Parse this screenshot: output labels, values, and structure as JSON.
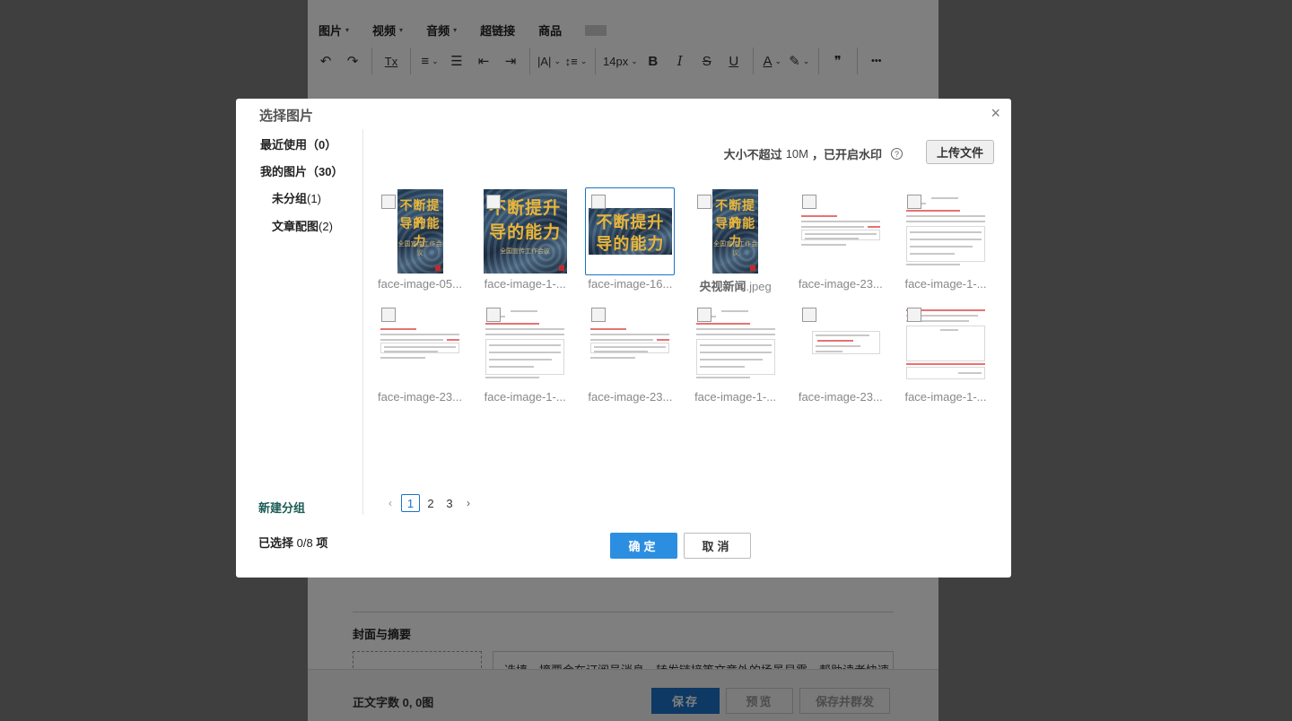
{
  "editor": {
    "insert_menu": [
      {
        "label": "图片",
        "dropdown": true
      },
      {
        "label": "视频",
        "dropdown": true
      },
      {
        "label": "音频",
        "dropdown": true
      },
      {
        "label": "超链接",
        "dropdown": false
      },
      {
        "label": "商品",
        "dropdown": false
      }
    ],
    "toolbar": {
      "undo_icon": "↶",
      "redo_icon": "↷",
      "clear_format_icon": "Tx",
      "align_icon": "≡",
      "line_list_icon": "☰",
      "outdent_icon": "⇤",
      "indent_icon": "⇥",
      "letter_spacing_icon": "|A|",
      "line_height_icon": "↕≡",
      "font_size": "14px",
      "bold_icon": "B",
      "italic_icon": "I",
      "strike_icon": "S",
      "underline_icon": "U",
      "font_color_icon": "A",
      "highlight_icon": "✎",
      "quote_icon": "❞",
      "more_icon": "•••",
      "dropdown_icon": "⌄"
    },
    "cover_section_title": "封面与摘要",
    "summary_placeholder": "选填，摘要会在订阅号消息、转发链接等文章外的场景显露，帮助读者快速",
    "word_count": "正文字数 0, 0图",
    "buttons": {
      "save": "保存",
      "preview": "预览",
      "save_and_send": "保存并群发"
    }
  },
  "modal": {
    "title": "选择图片",
    "close_icon": "×",
    "sidebar": {
      "recent": "最近使用（0）",
      "mine": "我的图片（30）",
      "groups": [
        {
          "label": "未分组",
          "count": "(1)"
        },
        {
          "label": "文章配图",
          "count": "(2)"
        }
      ],
      "new_group": "新建分组"
    },
    "upload_note_bold": "大小不超过",
    "upload_note_plain": "10M",
    "upload_note_rest": "，已开启水印",
    "help_icon": "?",
    "upload_button": "上传文件",
    "images": [
      {
        "name": "face-image-05...",
        "kind": "book-portrait",
        "selected": false
      },
      {
        "name": "face-image-1-...",
        "kind": "book-square",
        "selected": false
      },
      {
        "name": "face-image-16...",
        "kind": "book-wide",
        "selected": true
      },
      {
        "name_bold": "央视新闻",
        "name_rest": ".jpeg",
        "kind": "book-portrait",
        "selected": false
      },
      {
        "name": "face-image-23...",
        "kind": "shot-a",
        "selected": false
      },
      {
        "name": "face-image-1-...",
        "kind": "shot-b",
        "selected": false
      },
      {
        "name": "face-image-23...",
        "kind": "shot-a",
        "selected": false
      },
      {
        "name": "face-image-1-...",
        "kind": "shot-b",
        "selected": false
      },
      {
        "name": "face-image-23...",
        "kind": "shot-a",
        "selected": false
      },
      {
        "name": "face-image-1-...",
        "kind": "shot-b",
        "selected": false
      },
      {
        "name": "face-image-23...",
        "kind": "shot-c",
        "selected": false
      },
      {
        "name": "face-image-1-...",
        "kind": "shot-d",
        "selected": false
      }
    ],
    "cover_text_line1": "不断提升",
    "cover_text_line2": "导的能力",
    "cover_subtitle": "全国宣传工作会议",
    "pagination": {
      "prev_icon": "‹",
      "pages": [
        "1",
        "2",
        "3"
      ],
      "current": "1",
      "next_icon": "›"
    },
    "selected_label": "已选择",
    "selected_count": "0/8",
    "selected_unit": "项",
    "ok_button": "确定",
    "cancel_button": "取消"
  }
}
